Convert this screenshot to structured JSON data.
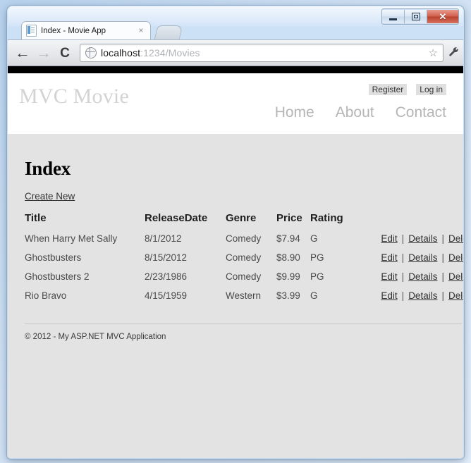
{
  "window": {
    "controls": {
      "minimize_label": "Minimize",
      "maximize_label": "Maximize",
      "close_label": "Close",
      "close_glyph": "✕"
    }
  },
  "browser": {
    "tab": {
      "title": "Index - Movie App",
      "close_glyph": "×",
      "favicon_name": "page-favicon"
    },
    "new_tab_label": "",
    "toolbar": {
      "back_glyph": "←",
      "forward_glyph": "→",
      "reload_glyph": "⟳",
      "star_glyph": "☆",
      "wrench_glyph": "🔧",
      "url_host": "localhost",
      "url_rest": ":1234/Movies",
      "url_full": "localhost:1234/Movies"
    }
  },
  "site": {
    "title": "MVC Movie",
    "account_links": [
      {
        "label": "Register"
      },
      {
        "label": "Log in"
      }
    ],
    "nav_links": [
      {
        "label": "Home"
      },
      {
        "label": "About"
      },
      {
        "label": "Contact"
      }
    ]
  },
  "main": {
    "heading": "Index",
    "create_link": "Create New",
    "table": {
      "columns": [
        "Title",
        "ReleaseDate",
        "Genre",
        "Price",
        "Rating"
      ],
      "action_labels": {
        "edit": "Edit",
        "details": "Details",
        "delete": "Delete",
        "separator": "|"
      },
      "rows": [
        {
          "title": "When Harry Met Sally",
          "release_date": "8/1/2012",
          "genre": "Comedy",
          "price": "$7.94",
          "rating": "G"
        },
        {
          "title": "Ghostbusters",
          "release_date": "8/15/2012",
          "genre": "Comedy",
          "price": "$8.90",
          "rating": "PG"
        },
        {
          "title": "Ghostbusters 2",
          "release_date": "2/23/1986",
          "genre": "Comedy",
          "price": "$9.99",
          "rating": "PG"
        },
        {
          "title": "Rio Bravo",
          "release_date": "4/15/1959",
          "genre": "Western",
          "price": "$3.99",
          "rating": "G"
        }
      ]
    }
  },
  "footer": {
    "text": "© 2012 - My ASP.NET MVC Application"
  },
  "colors": {
    "page_bg": "#e3e3e3",
    "header_bg": "#ffffff",
    "topbar": "#000000",
    "site_title": "#d3d3d3",
    "nav_link": "#b5b5b5",
    "accent_close": "#b8432f"
  }
}
